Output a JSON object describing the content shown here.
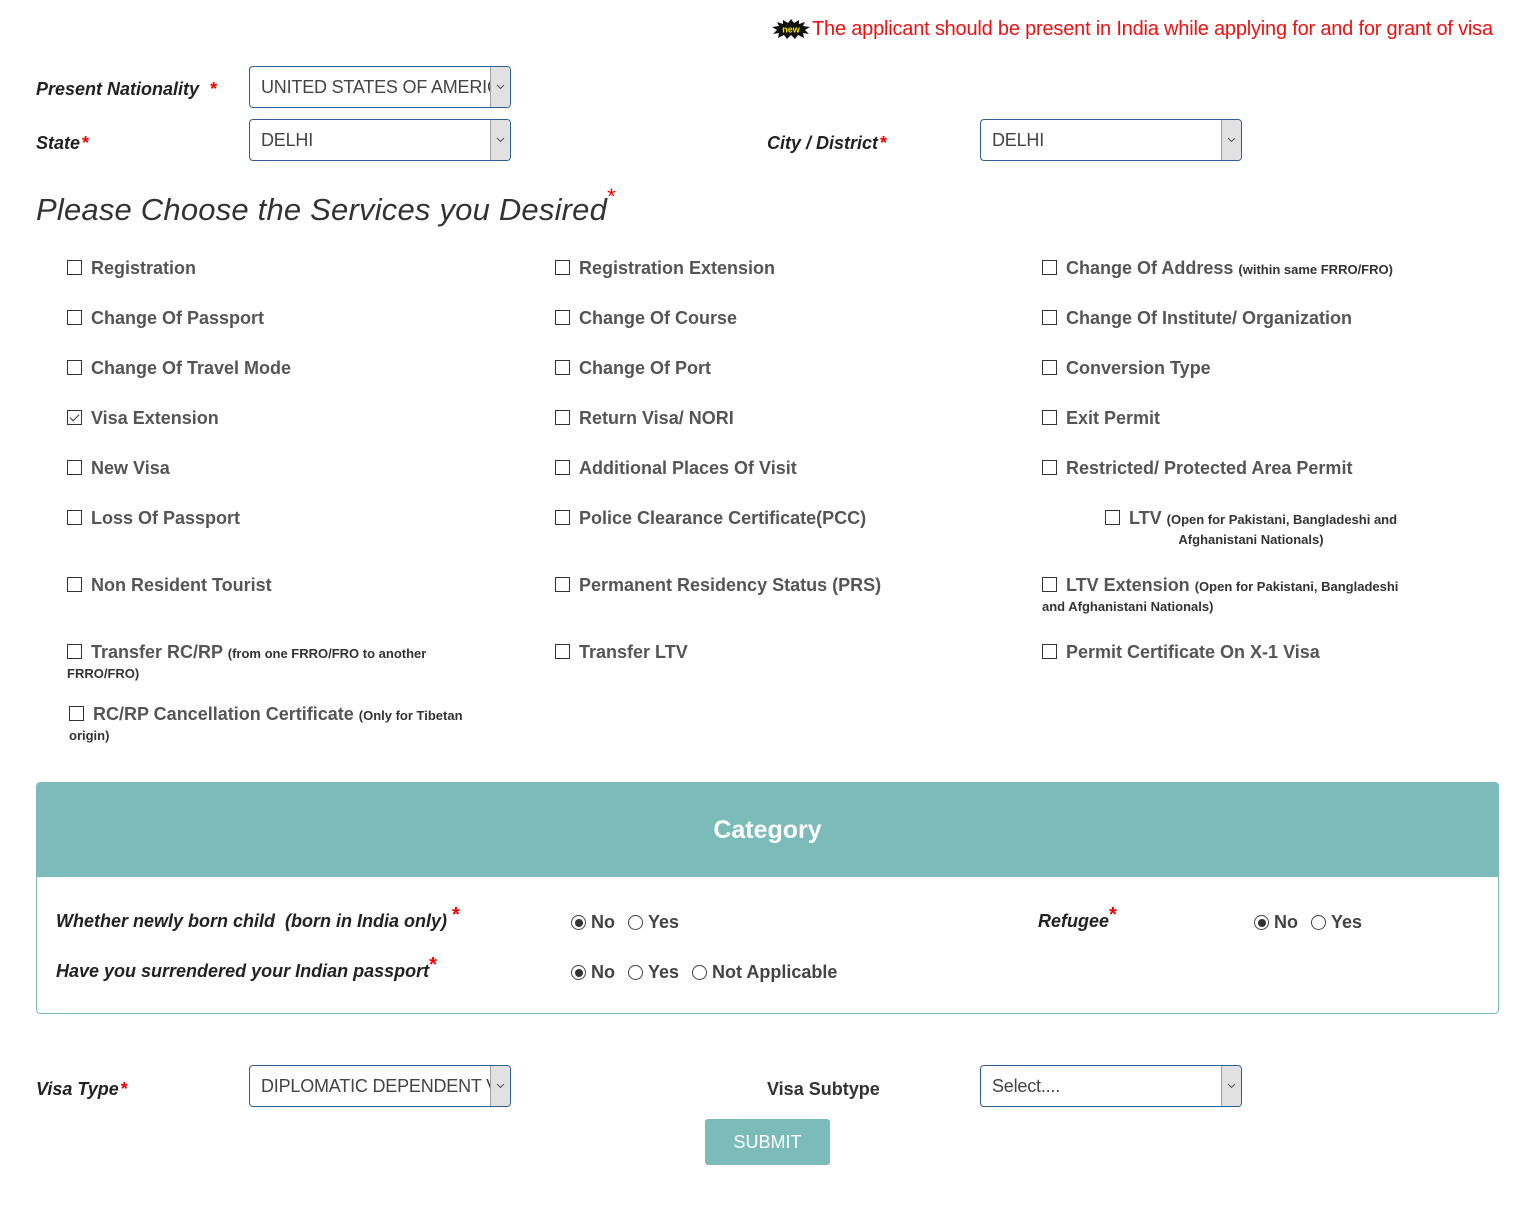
{
  "notice": {
    "badge_icon": "new-badge-icon",
    "badge_text": "new",
    "text": "The applicant should be present in India while applying for and for grant of visa"
  },
  "form": {
    "nationality": {
      "label": "Present Nationality",
      "required": "*",
      "value": "UNITED STATES OF AMERICA"
    },
    "state": {
      "label": "State",
      "required": "*",
      "value": "DELHI"
    },
    "city": {
      "label": "City / District",
      "required": "*",
      "value": "DELHI"
    }
  },
  "services": {
    "heading": "Please Choose the Services you Desired",
    "required": "*",
    "items": [
      {
        "label": "Registration",
        "note": "",
        "checked": false
      },
      {
        "label": "Registration Extension",
        "note": "",
        "checked": false
      },
      {
        "label": "Change Of Address",
        "note": "(within same FRRO/FRO)",
        "checked": false
      },
      {
        "label": "Change Of Passport",
        "note": "",
        "checked": false
      },
      {
        "label": "Change Of Course",
        "note": "",
        "checked": false
      },
      {
        "label": "Change Of Institute/ Organization",
        "note": "",
        "checked": false
      },
      {
        "label": "Change Of Travel Mode",
        "note": "",
        "checked": false
      },
      {
        "label": "Change Of Port",
        "note": "",
        "checked": false
      },
      {
        "label": "Conversion Type",
        "note": "",
        "checked": false
      },
      {
        "label": "Visa Extension",
        "note": "",
        "checked": true
      },
      {
        "label": "Return Visa/ NORI",
        "note": "",
        "checked": false
      },
      {
        "label": "Exit Permit",
        "note": "",
        "checked": false
      },
      {
        "label": "New Visa",
        "note": "",
        "checked": false
      },
      {
        "label": "Additional Places Of Visit",
        "note": "",
        "checked": false
      },
      {
        "label": "Restricted/ Protected Area Permit",
        "note": "",
        "checked": false
      },
      {
        "label": "Loss Of Passport",
        "note": "",
        "checked": false
      },
      {
        "label": "Police Clearance Certificate(PCC)",
        "note": "",
        "checked": false
      },
      {
        "label": "LTV",
        "note": "(Open for Pakistani, Bangladeshi and Afghanistani Nationals)",
        "checked": false
      },
      {
        "label": "Non Resident Tourist",
        "note": "",
        "checked": false
      },
      {
        "label": "Permanent Residency Status (PRS)",
        "note": "",
        "checked": false
      },
      {
        "label": "LTV Extension",
        "note": "(Open for Pakistani, Bangladeshi and Afghanistani Nationals)",
        "checked": false
      },
      {
        "label": "Transfer RC/RP",
        "note": "(from one FRRO/FRO to another FRRO/FRO)",
        "checked": false
      },
      {
        "label": "Transfer LTV",
        "note": "",
        "checked": false
      },
      {
        "label": "Permit Certificate On X-1 Visa",
        "note": "",
        "checked": false
      },
      {
        "label": "RC/RP Cancellation Certificate",
        "note": "(Only for Tibetan origin)",
        "checked": false
      }
    ]
  },
  "category": {
    "title": "Category",
    "questions": [
      {
        "label": "Whether newly born child  (born in India only)",
        "required": "*",
        "options": [
          "No",
          "Yes"
        ],
        "selected": "No"
      },
      {
        "label": "Refugee",
        "required": "*",
        "options": [
          "No",
          "Yes"
        ],
        "selected": "No"
      },
      {
        "label": "Have you surrendered your Indian passport",
        "required": "*",
        "options": [
          "No",
          "Yes",
          "Not Applicable"
        ],
        "selected": "No"
      }
    ]
  },
  "visa": {
    "type": {
      "label": "Visa Type",
      "required": "*",
      "value": "DIPLOMATIC DEPENDENT VISA"
    },
    "subtype": {
      "label": "Visa Subtype",
      "value": "Select...."
    }
  },
  "submit_label": "SUBMIT",
  "colors": {
    "accent": "#7bbcbb",
    "required": "#ee0000",
    "notice": "#ee1111",
    "select_border": "#2f5f93"
  }
}
